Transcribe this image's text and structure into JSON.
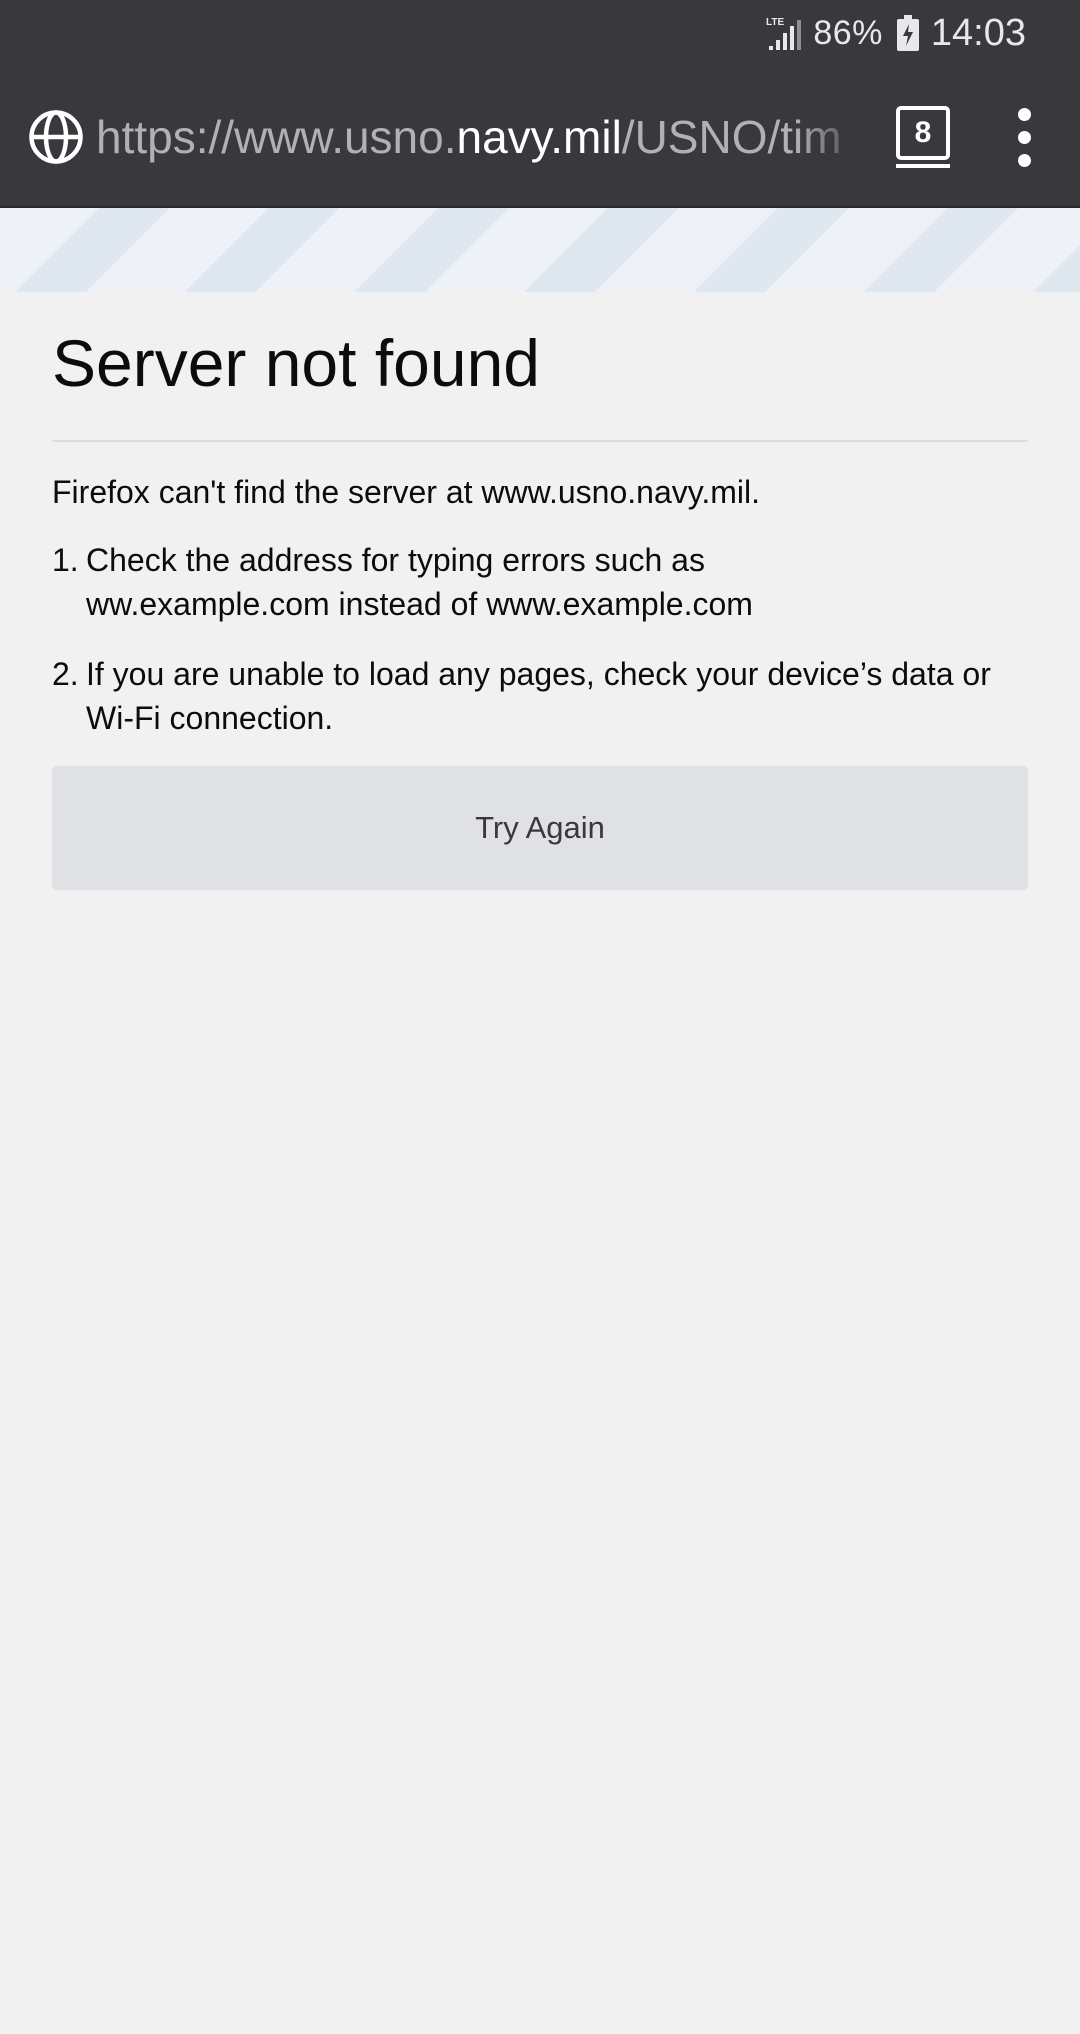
{
  "status_bar": {
    "network": "LTE",
    "battery": "86%",
    "time": "14:03"
  },
  "toolbar": {
    "url": {
      "prefix": "https://www.usno.",
      "host": "navy.mil",
      "path": "/USNO/tim"
    },
    "tab_count": "8",
    "icons": {
      "site": "globe-icon",
      "menu": "overflow-menu-icon"
    }
  },
  "error": {
    "title": "Server not found",
    "intro": "Firefox can't find the server at www.usno.navy.mil.",
    "steps": [
      {
        "num": "1.",
        "line1": "Check the address for typing errors such as",
        "bad_prefix": "ww",
        "bad_rest": ".example.com",
        "middle": " instead of ",
        "good_prefix": "www",
        "good_rest": ".example.com"
      },
      {
        "num": "2.",
        "text": "If you are unable to load any pages, check your device’s data or Wi-Fi connection."
      }
    ],
    "button_label": "Try Again"
  },
  "colors": {
    "chrome": "#38383d",
    "page_background": "#f1f1f1",
    "button_background": "#e0e1e5",
    "stripe_light": "#eef1f5",
    "stripe_dark": "#dfe7f0"
  }
}
